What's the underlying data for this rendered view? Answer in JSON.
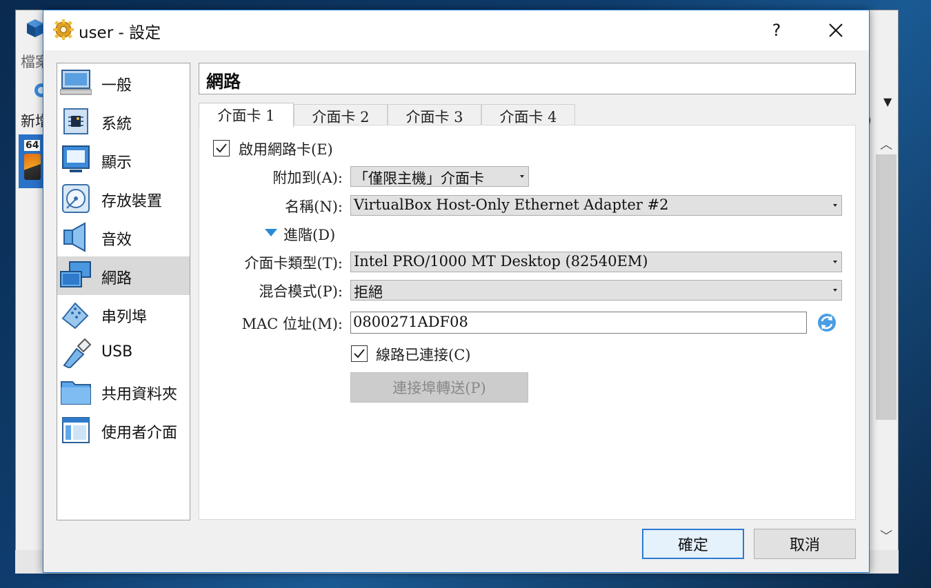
{
  "background_window": {
    "menu_label": "檔案",
    "new_label": "新增",
    "vm_badge": "64",
    "paren": ")"
  },
  "dialog": {
    "title": "user - 設定",
    "help_label": "?",
    "section_title": "網路",
    "ok_label": "確定",
    "cancel_label": "取消"
  },
  "nav": {
    "items": [
      {
        "label": "一般",
        "icon": "monitor-icon"
      },
      {
        "label": "系統",
        "icon": "chip-icon"
      },
      {
        "label": "顯示",
        "icon": "display-icon"
      },
      {
        "label": "存放裝置",
        "icon": "disk-icon"
      },
      {
        "label": "音效",
        "icon": "speaker-icon"
      },
      {
        "label": "網路",
        "icon": "network-icon"
      },
      {
        "label": "串列埠",
        "icon": "serial-port-icon"
      },
      {
        "label": "USB",
        "icon": "usb-icon"
      },
      {
        "label": "共用資料夾",
        "icon": "folder-icon"
      },
      {
        "label": "使用者介面",
        "icon": "window-icon"
      }
    ],
    "active_index": 5
  },
  "tabs": [
    {
      "label": "介面卡 1"
    },
    {
      "label": "介面卡 2"
    },
    {
      "label": "介面卡 3"
    },
    {
      "label": "介面卡 4"
    }
  ],
  "adapter": {
    "enable_label": "啟用網路卡(E)",
    "enable_checked": true,
    "attached_label": "附加到(A):",
    "attached_value": "「僅限主機」介面卡",
    "name_label": "名稱(N):",
    "name_value": "VirtualBox Host-Only Ethernet Adapter #2",
    "advanced_label": "進階(D)",
    "type_label": "介面卡類型(T):",
    "type_value": "Intel PRO/1000 MT Desktop (82540EM)",
    "promisc_label": "混合模式(P):",
    "promisc_value": "拒絕",
    "mac_label": "MAC 位址(M):",
    "mac_value": "0800271ADF08",
    "cable_label": "線路已連接(C)",
    "cable_checked": true,
    "port_forward_label": "連接埠轉送(P)"
  },
  "colors": {
    "accent": "#1874cd",
    "nav_active": "#d9d9d9",
    "disabled_button": "#cccccc"
  }
}
